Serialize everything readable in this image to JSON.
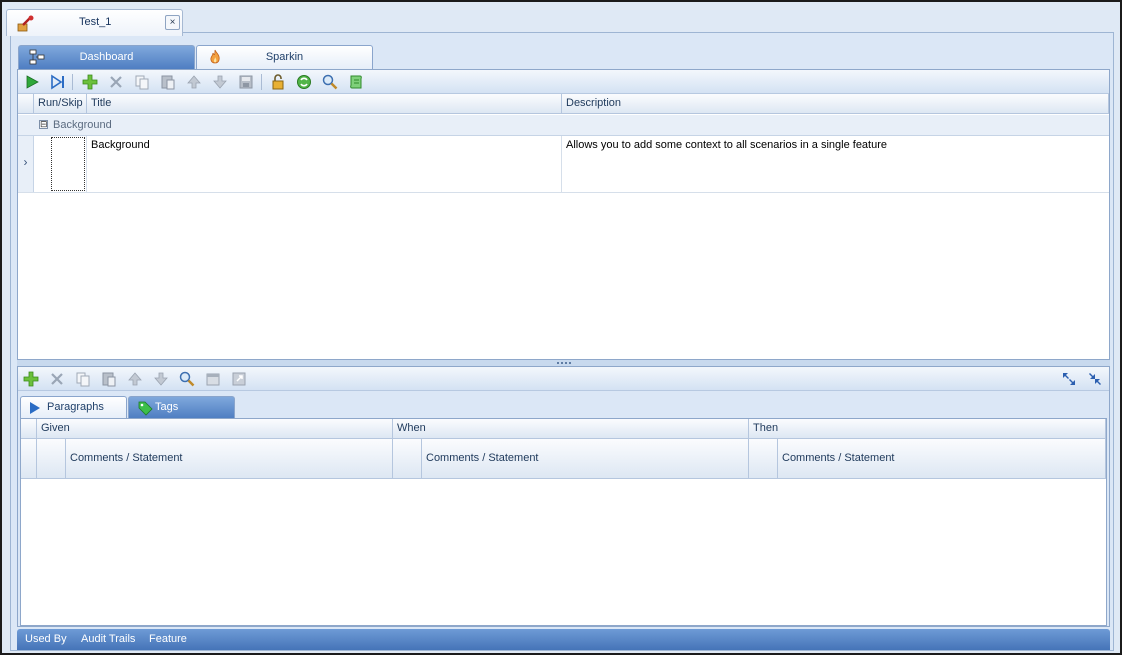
{
  "document": {
    "tab_title": "Test_1",
    "close_glyph": "×"
  },
  "main_tabs": [
    {
      "label": "Dashboard",
      "icon": "dashboard-icon"
    },
    {
      "label": "Sparkin",
      "icon": "flame-icon"
    }
  ],
  "scenario_toolbar": {
    "buttons": [
      "run-icon",
      "run-to-end-icon",
      "add-icon",
      "delete-icon",
      "copy-icon",
      "paste-icon",
      "move-up-icon",
      "move-down-icon",
      "save-icon",
      "unlock-icon",
      "refresh-icon",
      "search-icon",
      "script-icon"
    ]
  },
  "scenario_grid": {
    "columns": [
      "Run/Skip",
      "Title",
      "Description"
    ],
    "group": {
      "toggle": "⊟",
      "label": "Background"
    },
    "rows": [
      {
        "indicator": "›",
        "title": "Background",
        "description": "Allows you to add some context to all scenarios in a single feature"
      }
    ]
  },
  "steps_toolbar": {
    "buttons": [
      "add-icon",
      "delete-icon",
      "copy-icon",
      "paste-icon",
      "move-up-icon",
      "move-down-icon",
      "search-icon",
      "calendar-icon",
      "export-icon"
    ],
    "right_buttons": [
      "expand-all-icon",
      "collapse-all-icon"
    ]
  },
  "sub_tabs": [
    {
      "label": "Paragraphs",
      "icon": "play-icon"
    },
    {
      "label": "Tags",
      "icon": "tag-icon"
    }
  ],
  "steps_grid": {
    "groups": [
      "Given",
      "When",
      "Then"
    ],
    "sub_header": "Comments / Statement"
  },
  "footer": {
    "items": [
      "Used By",
      "Audit Trails",
      "Feature"
    ]
  }
}
